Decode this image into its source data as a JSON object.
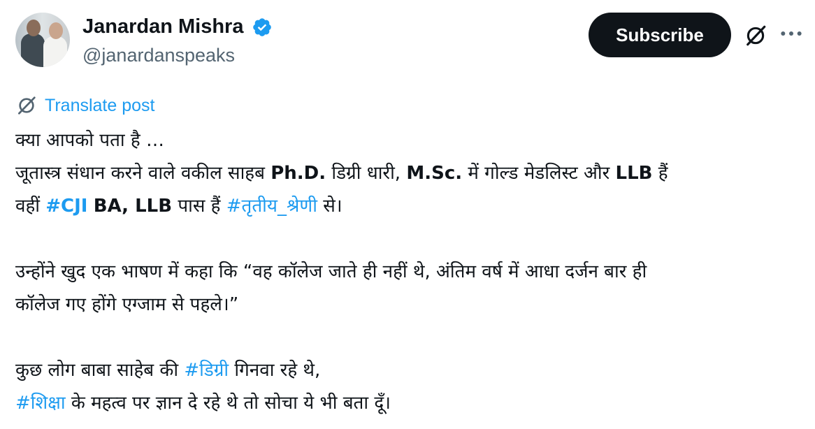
{
  "author": {
    "name": "Janardan Mishra",
    "handle": "@janardanspeaks",
    "verified": true,
    "avatar_icon": "profile-photo"
  },
  "actions": {
    "subscribe_label": "Subscribe",
    "grok_icon": "grok-icon",
    "more_icon": "more-icon"
  },
  "translate": {
    "label": "Translate post",
    "icon": "translate-icon"
  },
  "post": {
    "line1": "क्या आपको पता है …",
    "line2": {
      "t1": "जूतास्त्र संधान करने वाले वकील साहब ",
      "b1": "Ph.D.",
      "t2": " डिग्री धारी, ",
      "b2": "M.Sc.",
      "t3": " में गोल्ड मेडलिस्ट और ",
      "b3": "LLB",
      "t4": " हैं"
    },
    "line3": {
      "t1": "वहीं ",
      "h1": "#CJI",
      "t2": " ",
      "b1": "BA, LLB",
      "t3": " पास हैं ",
      "h2": "#तृतीय_श्रेणी",
      "t4": " से।"
    },
    "line4": "उन्होंने खुद एक भाषण में कहा कि “वह कॉलेज जाते ही नहीं थे, अंतिम वर्ष में आधा दर्जन बार ही",
    "line5": "कॉलेज गए होंगे एग्जाम से पहले।”",
    "line6": {
      "t1": "कुछ लोग बाबा साहेब की ",
      "h1": "#डिग्री",
      "t2": " गिनवा रहे थे,"
    },
    "line7": {
      "h1": "#शिक्षा",
      "t1": " के महत्व पर ज्ञान दे रहे थे तो सोचा ये भी बता दूँ।"
    }
  },
  "colors": {
    "text": "#0f1419",
    "secondary": "#536471",
    "accent": "#1d9bf0",
    "button_bg": "#0f1419"
  }
}
